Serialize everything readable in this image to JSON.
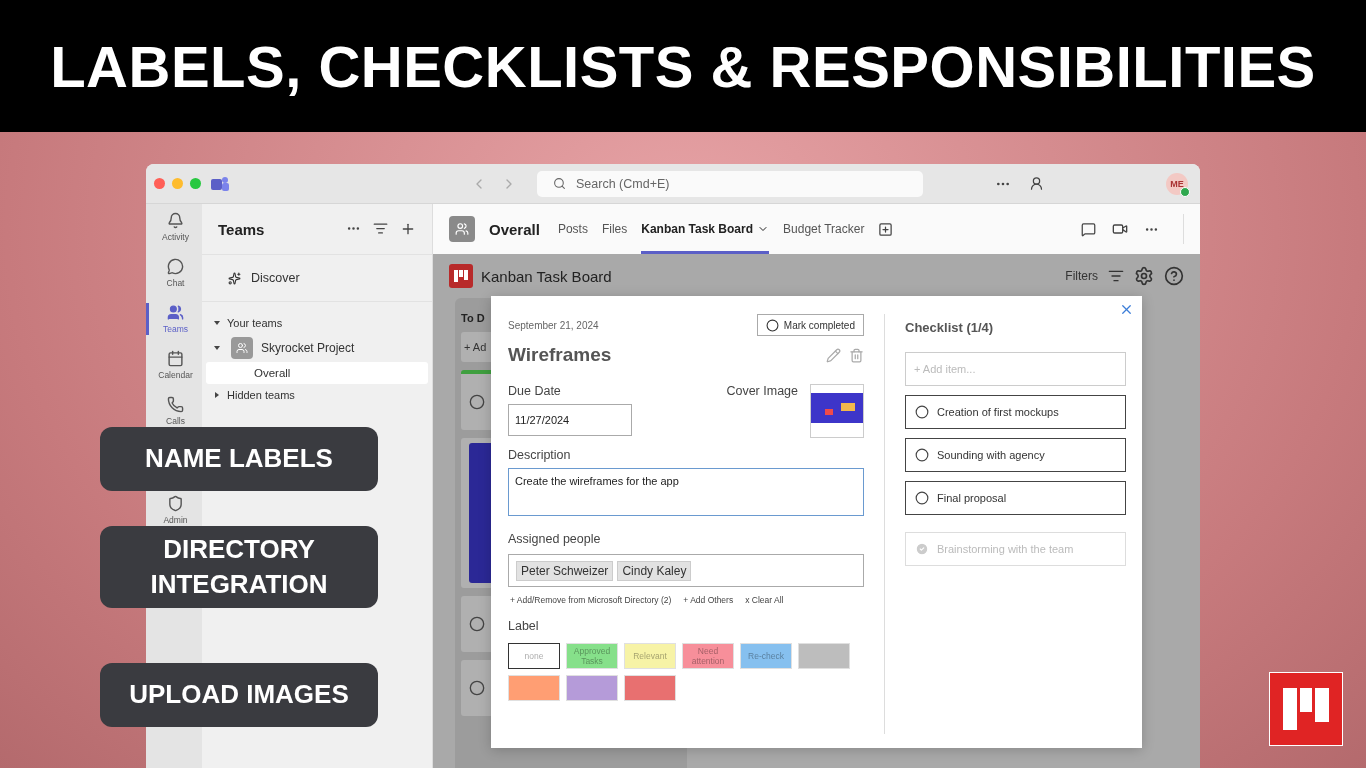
{
  "banner": {
    "title": "LABELS, CHECKLISTS & RESPONSIBILITIES"
  },
  "callouts": [
    "NAME LABELS",
    "DIRECTORY INTEGRATION",
    "UPLOAD IMAGES"
  ],
  "window": {
    "search_placeholder": "Search (Cmd+E)",
    "avatar": "ME"
  },
  "rail": [
    {
      "kind": "bell",
      "label": "Activity",
      "selected": false
    },
    {
      "kind": "chat",
      "label": "Chat",
      "selected": false
    },
    {
      "kind": "teams",
      "label": "Teams",
      "selected": true
    },
    {
      "kind": "calendar",
      "label": "Calendar",
      "selected": false
    },
    {
      "kind": "calls",
      "label": "Calls",
      "selected": false
    },
    {
      "kind": "admin",
      "label": "Admin",
      "selected": false
    }
  ],
  "teams_panel": {
    "title": "Teams",
    "discover": "Discover",
    "tree": [
      {
        "label": "Your teams",
        "expanded": true,
        "children": [
          {
            "label": "Skyrocket Project",
            "expanded": true,
            "children": [
              {
                "label": "Overall",
                "selected": true
              }
            ]
          }
        ]
      },
      {
        "label": "Hidden teams",
        "expanded": false
      }
    ]
  },
  "channel_header": {
    "name": "Overall",
    "tabs": [
      {
        "label": "Posts",
        "selected": false
      },
      {
        "label": "Files",
        "selected": false
      },
      {
        "label": "Kanban Task Board",
        "selected": true
      },
      {
        "label": "Budget Tracker",
        "selected": false
      }
    ]
  },
  "board": {
    "title": "Kanban Task Board",
    "filters": "Filters",
    "column": {
      "title": "To D",
      "add": "+ Ad"
    }
  },
  "task": {
    "date": "September 21, 2024",
    "mark_completed": "Mark completed",
    "completed": false,
    "title": "Wireframes",
    "due_label": "Due Date",
    "due": "11/27/2024",
    "cover_label": "Cover Image",
    "description_label": "Description",
    "description": "Create the wireframes for the app",
    "assigned_label": "Assigned people",
    "people": [
      "Peter Schweizer",
      "Cindy Kaley"
    ],
    "people_actions": [
      "+ Add/Remove from Microsoft Directory (2)",
      "+ Add Others",
      "x Clear All"
    ],
    "label_label": "Label",
    "labels": [
      {
        "text": "none",
        "color": "#ffffff",
        "selected": true
      },
      {
        "text": "Approved Tasks",
        "color": "#86e08a",
        "selected": false
      },
      {
        "text": "Relevant",
        "color": "#f7f3a6",
        "selected": false
      },
      {
        "text": "Need attention",
        "color": "#f78f9a",
        "selected": false
      },
      {
        "text": "Re-check",
        "color": "#86c0ef",
        "selected": false
      },
      {
        "color": "#bdbdbd",
        "selected": false
      },
      {
        "color": "#ff9e73",
        "selected": false
      },
      {
        "color": "#b59bd9",
        "selected": false
      },
      {
        "color": "#e87070",
        "selected": false
      }
    ]
  },
  "checklist": {
    "title": "Checklist (1/4)",
    "placeholder": "+ Add item...",
    "items": [
      {
        "text": "Creation of first mockups",
        "checked": false
      },
      {
        "text": "Sounding with agency",
        "checked": false
      },
      {
        "text": "Final proposal",
        "checked": false
      },
      {
        "text": "Brainstorming with the team",
        "checked": true
      }
    ]
  }
}
